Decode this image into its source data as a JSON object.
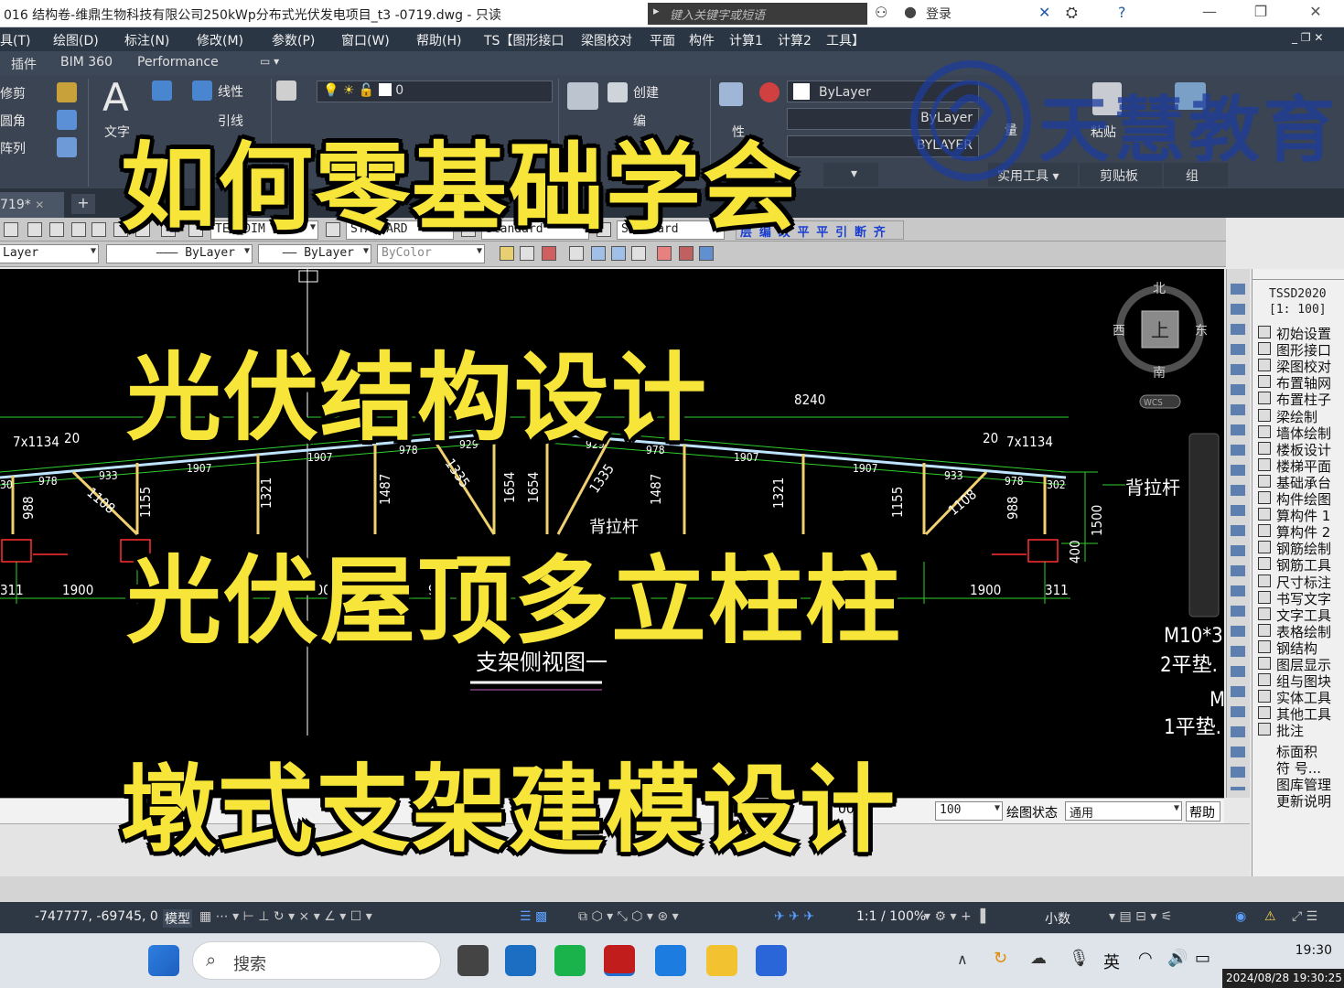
{
  "window": {
    "title": "016   结构卷-维鼎生物科技有限公司250kWp分布式光伏发电项目_t3 -0719.dwg - 只读",
    "search_placeholder": "键入关键字或短语",
    "login": "登录"
  },
  "menu": [
    "具(T)",
    "绘图(D)",
    "标注(N)",
    "修改(M)",
    "参数(P)",
    "窗口(W)",
    "帮助(H)",
    "TS【图形接口",
    "梁图校对",
    "平面",
    "构件",
    "计算1",
    "计算2",
    "工具】"
  ],
  "ribbon_tabs": [
    "插件",
    "BIM 360",
    "Performance"
  ],
  "ribbon": {
    "trim": "修剪",
    "fillet": "圆角",
    "array": "阵列",
    "text": "文字",
    "linear": "线性",
    "leader": "引线",
    "layer_value": "0",
    "create": "创建",
    "edit": "编",
    "bylayer_color": "ByLayer",
    "bylayer_line": "ByLayer",
    "bylayer_type": "BYLAYER",
    "properties": "性",
    "utilities": "实用工具",
    "clipboard": "剪贴板",
    "group": "组",
    "measure": "量",
    "paste": "粘贴"
  },
  "doc_tab": "719*",
  "toolbar1": {
    "dimstyle": "TEL_DIM",
    "textstyle": "STANDARD",
    "tablestyle": "Standard",
    "mleaderstyle": "Standard",
    "tools_text": "层 编 改 平 平 引 断 齐"
  },
  "toolbar2": {
    "layer": "Layer",
    "linetype": "ByLayer",
    "lineweight": "ByLayer",
    "color": "ByColor"
  },
  "viewcube": {
    "north": "北",
    "south": "南",
    "east": "东",
    "west": "西",
    "top": "上",
    "wcs": "WCS"
  },
  "drawing": {
    "dim_total": "8240",
    "dim_left_top": "7x1134",
    "dim_left_20": "20",
    "dim_right_20": "20",
    "dim_right_top": "7x1134",
    "dims": [
      "978",
      "933",
      "1907",
      "1907",
      "978",
      "929",
      "929",
      "978",
      "1907",
      "1907",
      "933",
      "978",
      "302",
      "30",
      "988",
      "1108",
      "1155",
      "1321",
      "1487",
      "1335",
      "1654",
      "1654",
      "1335",
      "1487",
      "1321",
      "1155",
      "1108",
      "988",
      "1500",
      "400"
    ],
    "bottom_dims": [
      "311",
      "1900",
      "900",
      "90",
      "1900",
      "311"
    ],
    "label_brace": "背拉杆",
    "label_brace2": "背拉杆",
    "title": "支架侧视图一",
    "note1": "M10*3",
    "note2": "2平垫.",
    "note3": "M",
    "note4": "1平垫."
  },
  "right_panel": {
    "header1": "TSSD2020",
    "header2": "[1: 100]",
    "items": [
      "初始设置",
      "图形接口",
      "梁图校对",
      "布置轴网",
      "布置柱子",
      "梁绘制",
      "墙体绘制",
      "楼板设计",
      "楼梯平面",
      "基础承台",
      "构件绘图",
      "算构件 1",
      "算构件 2",
      "钢筋绘制",
      "钢筋工具",
      "尺寸标注",
      "书写文字",
      "文字工具",
      "表格绘制",
      "钢结构",
      "图层显示",
      "组与图块",
      "实体工具",
      "其他工具",
      "批注",
      "标面积",
      "符 号...",
      "图库管理",
      "更新说明"
    ]
  },
  "cmdbar": {
    "scale_label": "00",
    "scale_value": "100",
    "state_label": "绘图状态",
    "state_value": "通用",
    "help": "帮助"
  },
  "status": {
    "coords": "-747777, -69745, 0",
    "model": "模型",
    "scale": "1:1 / 100%",
    "decimal": "小数"
  },
  "taskbar": {
    "search": "搜索",
    "ime": "英",
    "time": "19:30",
    "date": "2024/08/28 19:30:25"
  },
  "overlay": {
    "line1": "如何零基础学会",
    "line2": "光伏结构设计",
    "line3": "光伏屋顶多立柱柱",
    "line4": "墩式支架建模设计",
    "watermark": "天慧教育"
  }
}
